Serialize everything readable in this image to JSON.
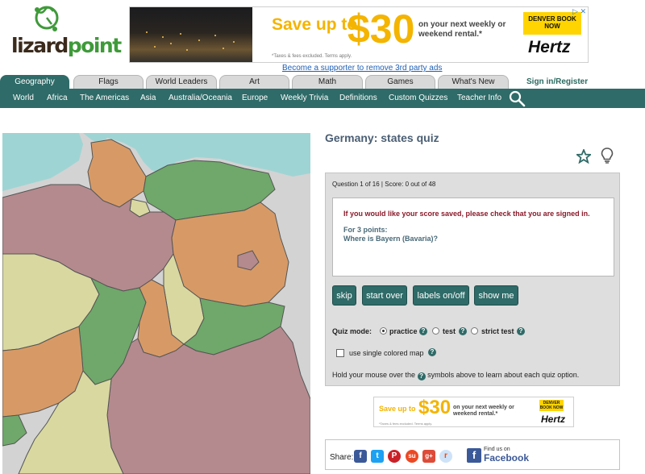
{
  "brand": {
    "logo_text_main": "lizard",
    "logo_text_accent": "point"
  },
  "ad_top": {
    "headline": "Save up to",
    "amount": "$30",
    "copy": "on your next weekly or weekend rental.*",
    "fine_print": "*Taxes & fees excluded. Terms apply.",
    "badge": "DENVER BOOK NOW",
    "brand": "Hertz",
    "close": "▷ ✕"
  },
  "supporter_link": "Become a supporter to remove 3rd party ads",
  "tabs": [
    {
      "label": "Geography",
      "active": true
    },
    {
      "label": "Flags",
      "active": false
    },
    {
      "label": "World Leaders",
      "active": false
    },
    {
      "label": "Art",
      "active": false
    },
    {
      "label": "Math",
      "active": false
    },
    {
      "label": "Games",
      "active": false
    },
    {
      "label": "What's New",
      "active": false
    }
  ],
  "signin": "Sign in/Register",
  "nav": [
    "World",
    "Africa",
    "The Americas",
    "Asia",
    "Australia/Oceania",
    "Europe",
    "Weekly Trivia",
    "Definitions",
    "Custom Quizzes",
    "Teacher Info"
  ],
  "quiz": {
    "title": "Germany: states quiz",
    "meta": "Question 1 of 16 | Score: 0 out of 48",
    "warning": "If you would like your score saved, please check that you are signed in.",
    "points": "For 3 points:",
    "question": "Where is Bayern (Bavaria)?",
    "buttons": {
      "skip": "skip",
      "start_over": "start over",
      "labels": "labels on/off",
      "show_me": "show me"
    },
    "mode_label": "Quiz mode:",
    "modes": {
      "practice": "practice",
      "test": "test",
      "strict": "strict test",
      "selected": "practice"
    },
    "single_map": "use single colored map",
    "help_glyph": "?",
    "hint_before": "Hold your mouse over the",
    "hint_after": "symbols above to learn about each quiz option."
  },
  "ad_small": {
    "headline": "Save up to",
    "amount": "$30",
    "copy": "on your next weekly or weekend rental.*",
    "fine_print": "*Taxes & fees excluded. Terms apply.",
    "badge": "DENVER BOOK NOW",
    "brand": "Hertz"
  },
  "share": {
    "label": "Share:",
    "icons": [
      {
        "name": "facebook-icon",
        "glyph": "f",
        "color": "#3b5998"
      },
      {
        "name": "twitter-icon",
        "glyph": "t",
        "color": "#1da1f2"
      },
      {
        "name": "pinterest-icon",
        "glyph": "P",
        "color": "#cb2027"
      },
      {
        "name": "stumbleupon-icon",
        "glyph": "su",
        "color": "#eb4924"
      },
      {
        "name": "googleplus-icon",
        "glyph": "g+",
        "color": "#dd4b39"
      },
      {
        "name": "reddit-icon",
        "glyph": "r",
        "color": "#cee3f8"
      }
    ],
    "fb_find": "Find us on",
    "fb_name": "Facebook"
  },
  "colors": {
    "teal": "#2f6b68",
    "map_sea": "#9fd4d4",
    "map_neighbors": "#d3d3d3",
    "state_orange": "#d79a66",
    "state_green": "#6fa86a",
    "state_mauve": "#b48a8e",
    "state_yellow": "#d8d8a0",
    "state_border": "#555555"
  }
}
